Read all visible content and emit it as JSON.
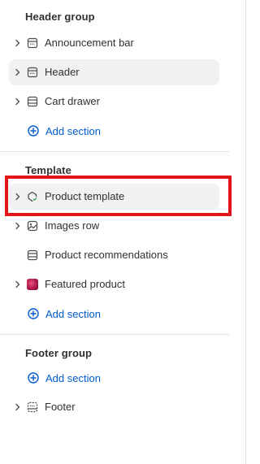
{
  "header_group": {
    "title": "Header group",
    "items": [
      {
        "label": "Announcement bar",
        "icon": "section-header-icon",
        "expandable": true
      },
      {
        "label": "Header",
        "icon": "section-header-icon",
        "expandable": true
      },
      {
        "label": "Cart drawer",
        "icon": "section-layout-icon",
        "expandable": true
      }
    ],
    "add_label": "Add section"
  },
  "template": {
    "title": "Template",
    "items": [
      {
        "label": "Product template",
        "icon": "product-check-icon",
        "expandable": true,
        "selected": true
      },
      {
        "label": "Images row",
        "icon": "image-icon",
        "expandable": true
      },
      {
        "label": "Product recommendations",
        "icon": "section-layout-icon",
        "expandable": false
      },
      {
        "label": "Featured product",
        "icon": "product-thumbnail",
        "expandable": true
      }
    ],
    "add_label": "Add section"
  },
  "footer_group": {
    "title": "Footer group",
    "add_label": "Add section",
    "items": [
      {
        "label": "Footer",
        "icon": "section-footer-icon",
        "expandable": true
      }
    ]
  },
  "colors": {
    "accent_link": "#005bd3",
    "highlight_border": "#e3141a",
    "selected_row_bg": "#f1f1f1"
  }
}
